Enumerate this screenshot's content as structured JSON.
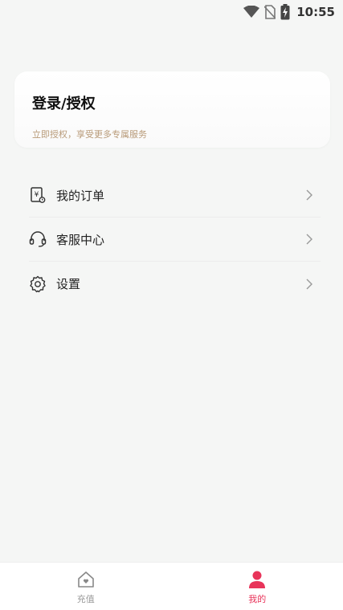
{
  "status_bar": {
    "time": "10:55",
    "icons": [
      "wifi-icon",
      "no-sim-icon",
      "battery-charging-icon"
    ]
  },
  "login_card": {
    "title": "登录/授权",
    "subtitle": "立即授权，享受更多专属服务"
  },
  "menu": {
    "items": [
      {
        "label": "我的订单",
        "icon": "order-receipt-icon"
      },
      {
        "label": "客服中心",
        "icon": "headset-icon"
      },
      {
        "label": "设置",
        "icon": "gear-icon"
      }
    ]
  },
  "bottom_nav": {
    "items": [
      {
        "label": "充值",
        "icon": "home-heart-icon",
        "active": false
      },
      {
        "label": "我的",
        "icon": "user-icon",
        "active": true
      }
    ]
  },
  "colors": {
    "accent": "#e8345a",
    "subtitle": "#b89a78",
    "background": "#f5f6f5"
  }
}
